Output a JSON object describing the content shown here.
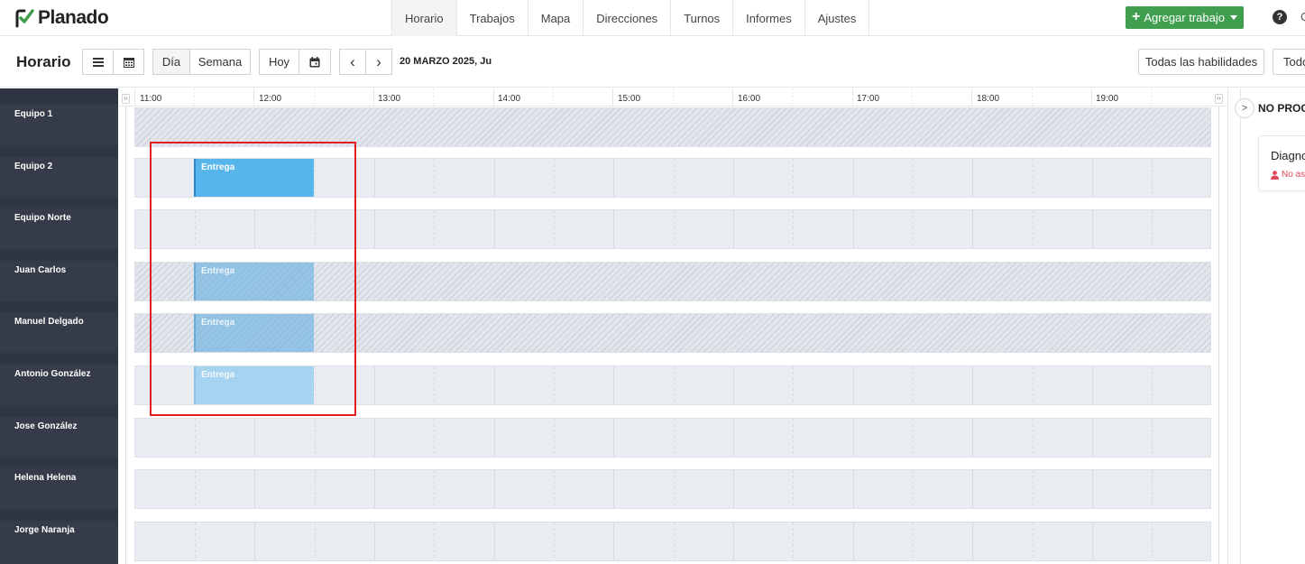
{
  "app": {
    "logo_text": "Planado",
    "nav": [
      "Horario",
      "Trabajos",
      "Mapa",
      "Direcciones",
      "Turnos",
      "Informes",
      "Ajustes"
    ],
    "active_nav": "Horario",
    "add_job_label": "Agregar trabajo",
    "help_label": "?",
    "user_initial": "C"
  },
  "toolbar": {
    "page_title": "Horario",
    "day_label": "Día",
    "week_label": "Semana",
    "today_label": "Hoy",
    "prev_label": "‹",
    "next_label": "›",
    "date_label": "20 MARZO 2025, Ju",
    "skills_filter": "Todas las habilidades",
    "second_filter": "Todo"
  },
  "timeline": {
    "hours": [
      "11:00",
      "12:00",
      "13:00",
      "14:00",
      "15:00",
      "16:00",
      "17:00",
      "18:00",
      "19:00"
    ]
  },
  "resources": [
    {
      "name": "Equipo 1",
      "unavailable": true,
      "jobs": []
    },
    {
      "name": "Equipo 2",
      "unavailable": false,
      "jobs": [
        {
          "label": "Entrega",
          "style": "solid"
        }
      ]
    },
    {
      "name": "Equipo Norte",
      "unavailable": false,
      "jobs": []
    },
    {
      "name": "Juan Carlos",
      "unavailable": true,
      "jobs": [
        {
          "label": "Entrega",
          "style": "faded"
        }
      ]
    },
    {
      "name": "Manuel Delgado",
      "unavailable": true,
      "jobs": [
        {
          "label": "Entrega",
          "style": "faded"
        }
      ]
    },
    {
      "name": "Antonio González",
      "unavailable": false,
      "jobs": [
        {
          "label": "Entrega",
          "style": "light"
        }
      ]
    },
    {
      "name": "Jose González",
      "unavailable": false,
      "jobs": []
    },
    {
      "name": "Helena Helena",
      "unavailable": false,
      "jobs": []
    },
    {
      "name": "Jorge Naranja",
      "unavailable": false,
      "jobs": []
    }
  ],
  "unscheduled": {
    "title": "NO PROG",
    "card_title": "Diagno",
    "card_status": "No asi"
  },
  "colors": {
    "accent_green": "#3f9f4e",
    "job_blue": "#56b5ea",
    "highlight_red": "#e02020",
    "unassigned_red": "#e0475a"
  }
}
